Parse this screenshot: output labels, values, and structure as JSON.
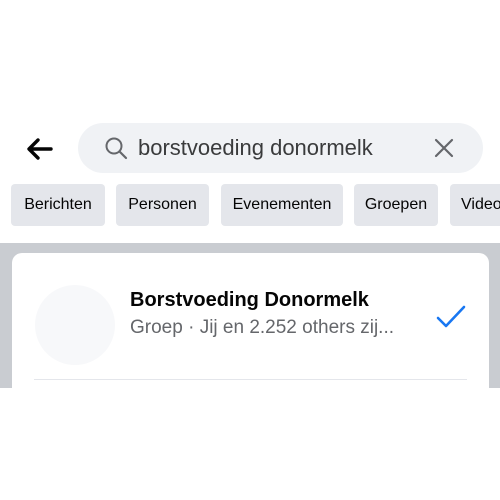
{
  "search": {
    "query": "borstvoeding donormelk",
    "back_icon": "arrow-left-icon",
    "search_icon": "search-icon",
    "clear_icon": "close-icon"
  },
  "filters": [
    {
      "label": "Berichten"
    },
    {
      "label": "Personen"
    },
    {
      "label": "Evenementen"
    },
    {
      "label": "Groepen"
    },
    {
      "label": "Video's"
    }
  ],
  "results": [
    {
      "title": "Borstvoeding Donormelk",
      "subtitle": "Groep · Jij en 2.252 others zij...",
      "status_icon": "checkmark-icon"
    }
  ],
  "colors": {
    "accent": "#1877f2",
    "chip_bg": "#e4e6eb",
    "search_bg": "#f0f2f5",
    "results_bg": "#c9ccd1"
  }
}
